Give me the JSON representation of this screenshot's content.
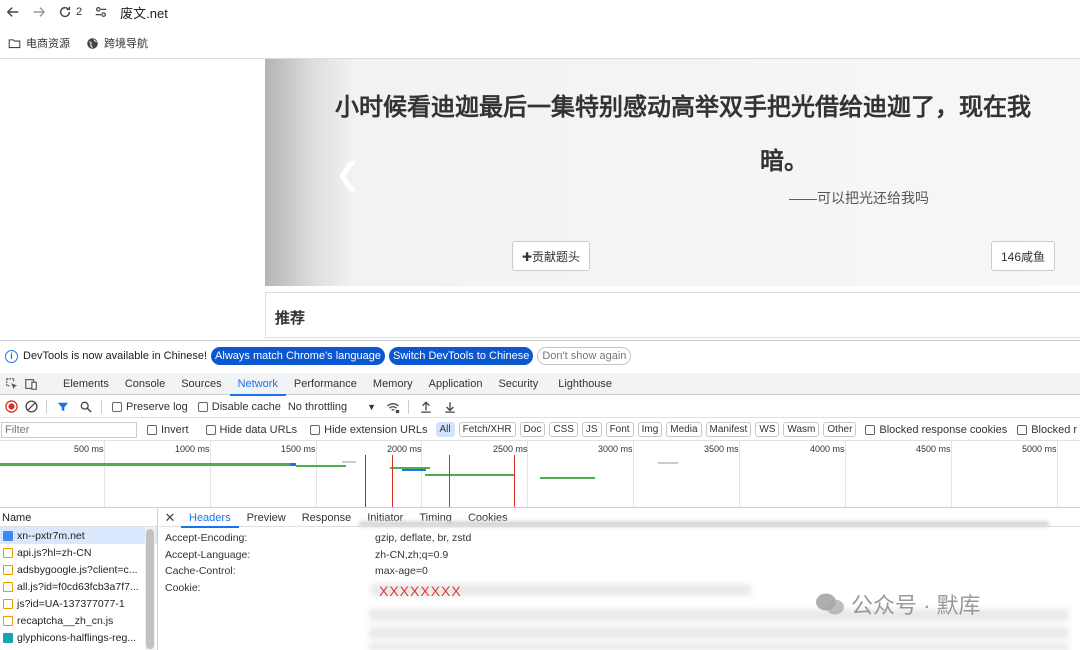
{
  "browser": {
    "tab_count": "2",
    "url": "废文.net",
    "bookmarks": [
      {
        "label": "电商资源",
        "icon": "folder-icon"
      },
      {
        "label": "跨境导航",
        "icon": "globe-icon"
      }
    ]
  },
  "page": {
    "carousel_title_line1": "小时候看迪迦最后一集特别感动高举双手把光借给迪迦了，现在我",
    "carousel_title_line2": "暗。",
    "carousel_subtitle": "——可以把光还给我吗",
    "contribute_button": "✚贡献题头",
    "author_button": "146咸鱼",
    "recommend_heading": "推荐"
  },
  "devtools": {
    "infobar": {
      "message": "DevTools is now available in Chinese!",
      "btn_match": "Always match Chrome's language",
      "btn_switch": "Switch DevTools to Chinese",
      "btn_dismiss": "Don't show again"
    },
    "tabs": [
      "Elements",
      "Console",
      "Sources",
      "Network",
      "Performance",
      "Memory",
      "Application",
      "Security",
      "Lighthouse"
    ],
    "active_tab": "Network",
    "toolbar": {
      "preserve_log": "Preserve log",
      "disable_cache": "Disable cache",
      "throttling": "No throttling"
    },
    "filter": {
      "placeholder": "Filter",
      "invert": "Invert",
      "hide_data_urls": "Hide data URLs",
      "hide_extension_urls": "Hide extension URLs",
      "types": [
        "All",
        "Fetch/XHR",
        "Doc",
        "CSS",
        "JS",
        "Font",
        "Img",
        "Media",
        "Manifest",
        "WS",
        "Wasm",
        "Other"
      ],
      "blocked_cookies": "Blocked response cookies",
      "blocked_requests": "Blocked r"
    },
    "timeline_ticks": [
      "500 ms",
      "1000 ms",
      "1500 ms",
      "2000 ms",
      "2500 ms",
      "3000 ms",
      "3500 ms",
      "4000 ms",
      "4500 ms",
      "5000 ms"
    ],
    "requests": {
      "header": "Name",
      "items": [
        {
          "name": "xn--pxtr7m.net",
          "type": "doc"
        },
        {
          "name": "api.js?hl=zh-CN",
          "type": "script"
        },
        {
          "name": "adsbygoogle.js?client=c...",
          "type": "script"
        },
        {
          "name": "all.js?id=f0cd63fcb3a7f7...",
          "type": "script"
        },
        {
          "name": "js?id=UA-137377077-1",
          "type": "script"
        },
        {
          "name": "recaptcha__zh_cn.js",
          "type": "script"
        },
        {
          "name": "glyphicons-halflings-reg...",
          "type": "font"
        }
      ]
    },
    "detail": {
      "tabs": [
        "Headers",
        "Preview",
        "Response",
        "Initiator",
        "Timing",
        "Cookies"
      ],
      "active_tab": "Headers",
      "headers": [
        {
          "key": "Accept-Encoding:",
          "value": "gzip, deflate, br, zstd"
        },
        {
          "key": "Accept-Language:",
          "value": "zh-CN,zh;q=0.9"
        },
        {
          "key": "Cache-Control:",
          "value": "max-age=0"
        },
        {
          "key": "Cookie:",
          "value": ""
        }
      ],
      "cookie_redacted": "XXXXXXXX"
    }
  },
  "watermark": "公众号 · 默库"
}
